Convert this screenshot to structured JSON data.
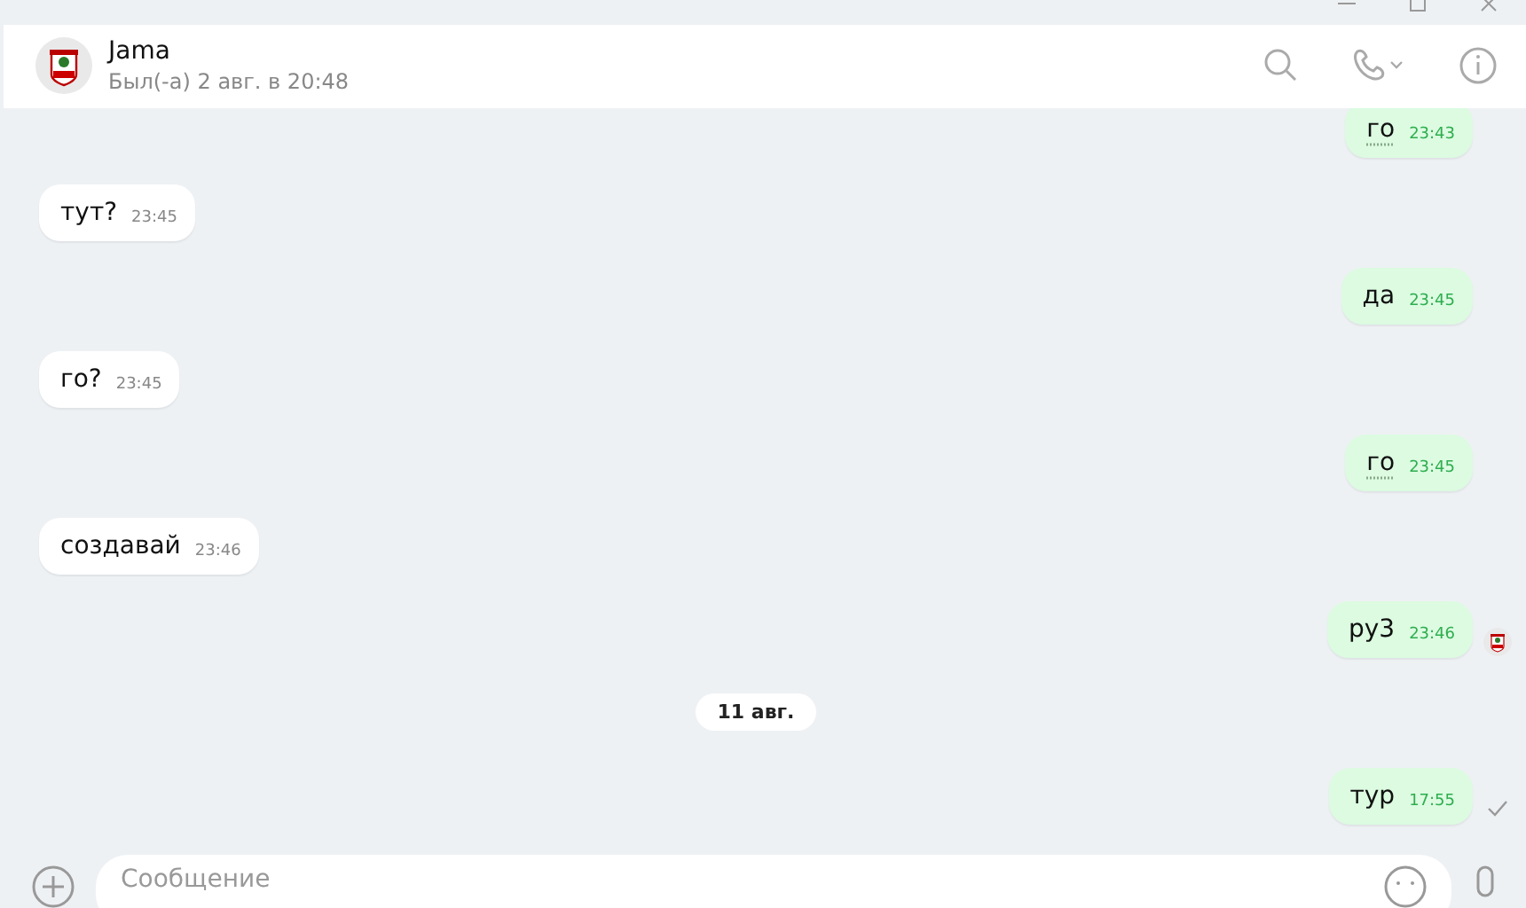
{
  "contact": {
    "name": "Jama",
    "status": "Был(-а) 2 авг. в 20:48"
  },
  "messages": [
    {
      "kind": "message",
      "outgoing": true,
      "text": "го",
      "time": "23:43",
      "spellcheck": true,
      "seen": false,
      "delivered": false
    },
    {
      "kind": "message",
      "outgoing": false,
      "text": "тут?",
      "time": "23:45",
      "spellcheck": false,
      "seen": false,
      "delivered": false
    },
    {
      "kind": "message",
      "outgoing": true,
      "text": "да",
      "time": "23:45",
      "spellcheck": false,
      "seen": false,
      "delivered": false
    },
    {
      "kind": "message",
      "outgoing": false,
      "text": "го?",
      "time": "23:45",
      "spellcheck": false,
      "seen": false,
      "delivered": false
    },
    {
      "kind": "message",
      "outgoing": true,
      "text": "го",
      "time": "23:45",
      "spellcheck": true,
      "seen": false,
      "delivered": false
    },
    {
      "kind": "message",
      "outgoing": false,
      "text": "создавай",
      "time": "23:46",
      "spellcheck": false,
      "seen": false,
      "delivered": false
    },
    {
      "kind": "message",
      "outgoing": true,
      "text": "ру3",
      "time": "23:46",
      "spellcheck": false,
      "seen": true,
      "delivered": false
    },
    {
      "kind": "date",
      "text": "11 авг."
    },
    {
      "kind": "message",
      "outgoing": true,
      "text": "тур",
      "time": "17:55",
      "spellcheck": false,
      "seen": false,
      "delivered": true
    }
  ],
  "composer": {
    "placeholder": "Сообщение"
  }
}
